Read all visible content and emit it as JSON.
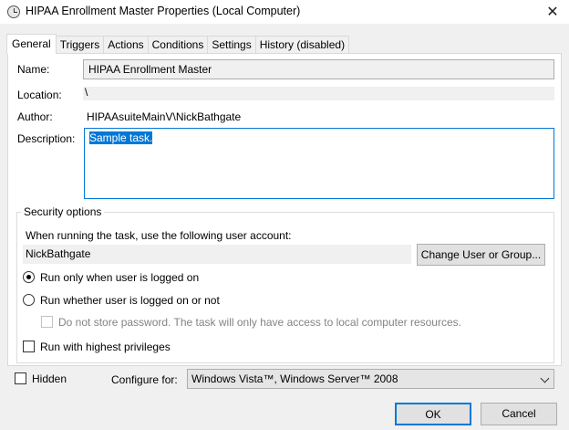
{
  "window": {
    "title": "HIPAA Enrollment Master Properties (Local Computer)",
    "close_glyph": "✕",
    "icon": "task-scheduler-icon"
  },
  "tabs": [
    {
      "label": "General",
      "active": true
    },
    {
      "label": "Triggers"
    },
    {
      "label": "Actions"
    },
    {
      "label": "Conditions"
    },
    {
      "label": "Settings"
    },
    {
      "label": "History (disabled)"
    }
  ],
  "general": {
    "name_label": "Name:",
    "name_value": "HIPAA Enrollment Master",
    "location_label": "Location:",
    "location_value": "\\",
    "author_label": "Author:",
    "author_value": "HIPAAsuiteMainV\\NickBathgate",
    "description_label": "Description:",
    "description_value": "Sample task."
  },
  "security": {
    "title": "Security options",
    "account_prompt": "When running the task, use the following user account:",
    "account_value": "NickBathgate",
    "change_button": "Change User or Group...",
    "radio_logged_on": "Run only when user is logged on",
    "radio_whether": "Run whether user is logged on or not",
    "no_store_password": "Do not store password.  The task will only have access to local computer resources.",
    "highest_privileges": "Run with highest privileges"
  },
  "footer": {
    "hidden_label": "Hidden",
    "configure_label": "Configure for:",
    "configure_value": "Windows Vista™, Windows Server™ 2008",
    "ok_button": "OK",
    "cancel_button": "Cancel"
  },
  "colors": {
    "accent": "#0078d7",
    "window_bg": "#f0f0f0",
    "panel_bg": "#ffffff"
  }
}
